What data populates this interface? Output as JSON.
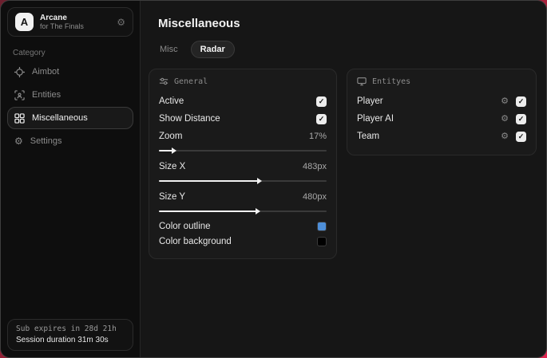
{
  "app": {
    "logo_letter": "A",
    "name": "Arcane",
    "subtitle": "for The Finals"
  },
  "sidebar": {
    "category_label": "Category",
    "items": [
      {
        "label": "Aimbot",
        "selected": false
      },
      {
        "label": "Entities",
        "selected": false
      },
      {
        "label": "Miscellaneous",
        "selected": true
      },
      {
        "label": "Settings",
        "selected": false
      }
    ],
    "footer": {
      "sub_expires": "Sub expires in 28d 21h",
      "session_duration": "Session duration 31m 30s"
    }
  },
  "main": {
    "title": "Miscellaneous",
    "tabs": [
      {
        "label": "Misc",
        "active": false
      },
      {
        "label": "Radar",
        "active": true
      }
    ],
    "general": {
      "header": "General",
      "active": {
        "label": "Active",
        "checked": true
      },
      "show_distance": {
        "label": "Show Distance",
        "checked": true
      },
      "zoom": {
        "label": "Zoom",
        "value": "17%",
        "fill_percent": 8
      },
      "size_x": {
        "label": "Size X",
        "value": "483px",
        "fill_percent": 59
      },
      "size_y": {
        "label": "Size Y",
        "value": "480px",
        "fill_percent": 58
      },
      "color_outline": {
        "label": "Color outline",
        "color": "#4e8fd9"
      },
      "color_background": {
        "label": "Color background",
        "color": "#000000"
      }
    },
    "entities": {
      "header": "Entityes",
      "rows": [
        {
          "label": "Player",
          "checked": true
        },
        {
          "label": "Player AI",
          "checked": true
        },
        {
          "label": "Team",
          "checked": true
        }
      ]
    }
  },
  "colors": {
    "outline_swatch": "#4e8fd9",
    "background_swatch": "#000000",
    "accent_border": "#3a3a3a"
  }
}
